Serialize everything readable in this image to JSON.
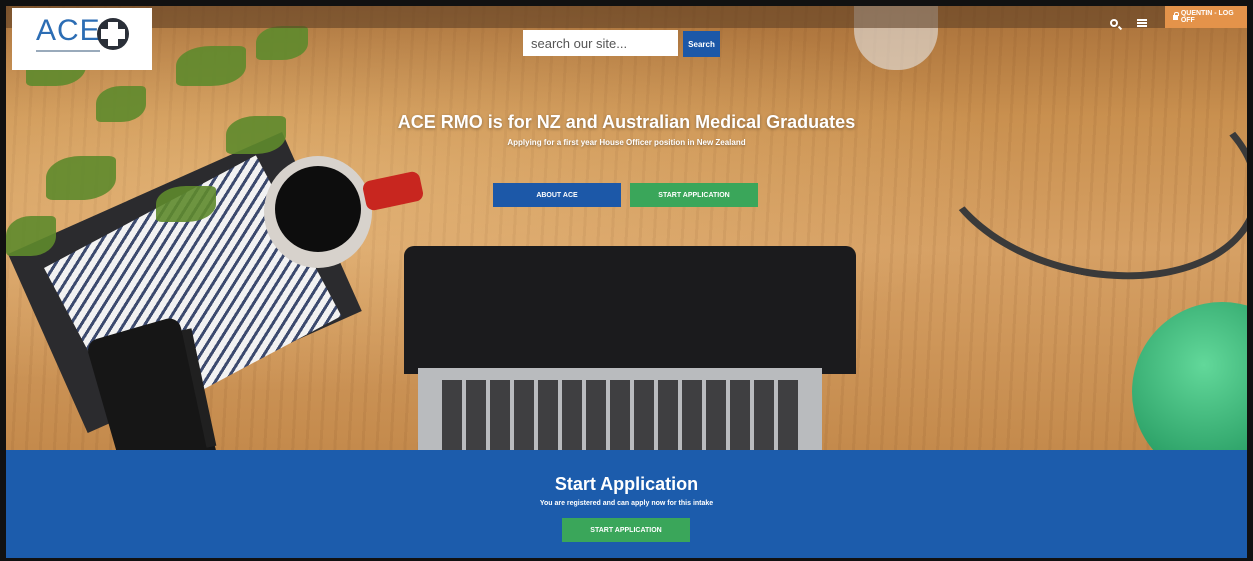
{
  "logo": {
    "text": "ACE",
    "icon": "globe-cross-icon"
  },
  "header": {
    "search_icon": "search-icon",
    "menu_icon": "menu-icon",
    "user_label": "QUENTIN - LOG OFF",
    "user_icon": "lock-icon",
    "user_color": "#e4934a"
  },
  "search": {
    "placeholder": "search our site...",
    "button_label": "Search"
  },
  "hero": {
    "title": "ACE RMO is for NZ and Australian Medical Graduates",
    "subtitle": "Applying for a first year House Officer position in New Zealand",
    "about_label": "ABOUT ACE",
    "start_label": "START APPLICATION"
  },
  "band": {
    "title": "Start Application",
    "subtitle": "You are registered and can apply now for this intake",
    "button_label": "START APPLICATION"
  },
  "colors": {
    "primary": "#1c58a8",
    "success": "#3aa65a",
    "band": "#1c5cac"
  }
}
